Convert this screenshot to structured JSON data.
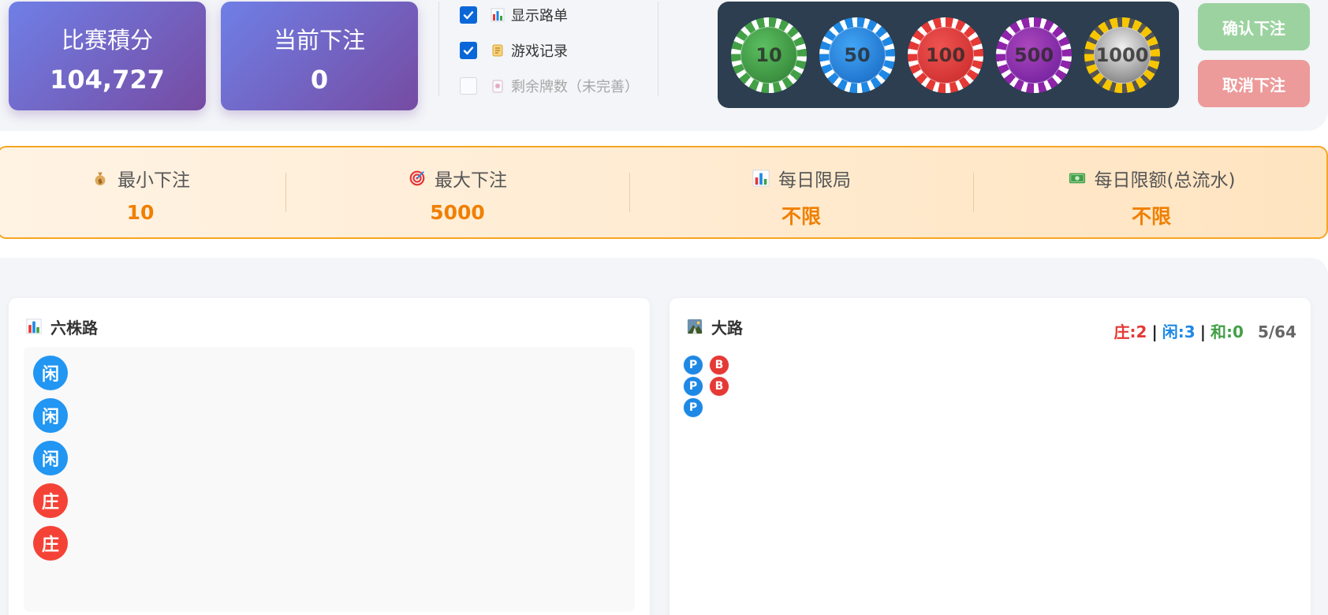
{
  "stats": {
    "score_label": "比赛積分",
    "score_value": "104,727",
    "bet_label": "当前下注",
    "bet_value": "0"
  },
  "options": [
    {
      "label": "显示路单",
      "checked": true,
      "disabled": false,
      "icon": "bar-chart-icon"
    },
    {
      "label": "游戏记录",
      "checked": true,
      "disabled": false,
      "icon": "scroll-icon"
    },
    {
      "label": "剩余牌数（未完善）",
      "checked": false,
      "disabled": true,
      "icon": "cards-icon"
    }
  ],
  "chips": [
    {
      "value": "10",
      "color": "#43a047"
    },
    {
      "value": "50",
      "color": "#1e88e5"
    },
    {
      "value": "100",
      "color": "#e53935"
    },
    {
      "value": "500",
      "color": "#8e24aa"
    },
    {
      "value": "1000",
      "color": "#9e9e9e"
    }
  ],
  "actions": {
    "confirm_label": "确认下注",
    "cancel_label": "取消下注"
  },
  "limits": [
    {
      "label": "最小下注",
      "value": "10",
      "icon": "money-bag-icon"
    },
    {
      "label": "最大下注",
      "value": "5000",
      "icon": "target-icon"
    },
    {
      "label": "每日限局",
      "value": "不限",
      "icon": "bar-chart-icon"
    },
    {
      "label": "每日限额(总流水)",
      "value": "不限",
      "icon": "banknote-icon"
    }
  ],
  "bead_road": {
    "title": "六株路",
    "results": [
      "闲",
      "闲",
      "闲",
      "庄",
      "庄"
    ]
  },
  "big_road": {
    "title": "大路",
    "banker_stat": "庄:2",
    "player_stat": "闲:3",
    "tie_stat": "和:0",
    "separator": "|",
    "count": "5/64",
    "columns": [
      [
        "P",
        "P",
        "P"
      ],
      [
        "B",
        "B"
      ]
    ]
  },
  "colors": {
    "player": "#2196f3",
    "banker": "#f44336",
    "tie": "#43a047",
    "accent": "#f07f00"
  }
}
